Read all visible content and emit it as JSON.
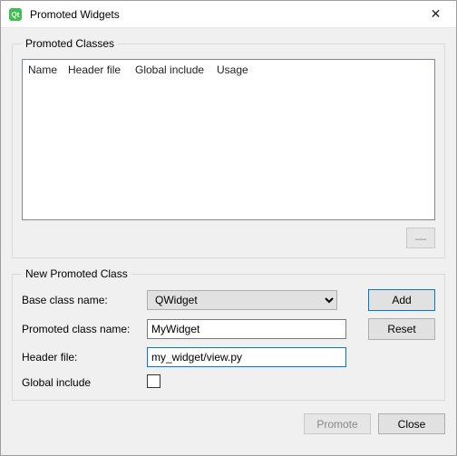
{
  "window": {
    "title": "Promoted Widgets",
    "close_symbol": "✕"
  },
  "promoted_classes": {
    "legend": "Promoted Classes",
    "columns": {
      "name": "Name",
      "header": "Header file",
      "global": "Global include",
      "usage": "Usage"
    },
    "rows": [],
    "remove_label": "—"
  },
  "new_class": {
    "legend": "New Promoted Class",
    "base_label": "Base class name:",
    "base_value": "QWidget",
    "base_options": [
      "QWidget"
    ],
    "promoted_label": "Promoted class name:",
    "promoted_value": "MyWidget",
    "header_label": "Header file:",
    "header_value": "my_widget/view.py",
    "global_label": "Global include",
    "global_checked": false,
    "add_label": "Add",
    "reset_label": "Reset"
  },
  "footer": {
    "promote_label": "Promote",
    "close_label": "Close"
  },
  "colors": {
    "accent": "#0078d7",
    "panel_bg": "#f0f0f0",
    "border": "#adadad"
  }
}
